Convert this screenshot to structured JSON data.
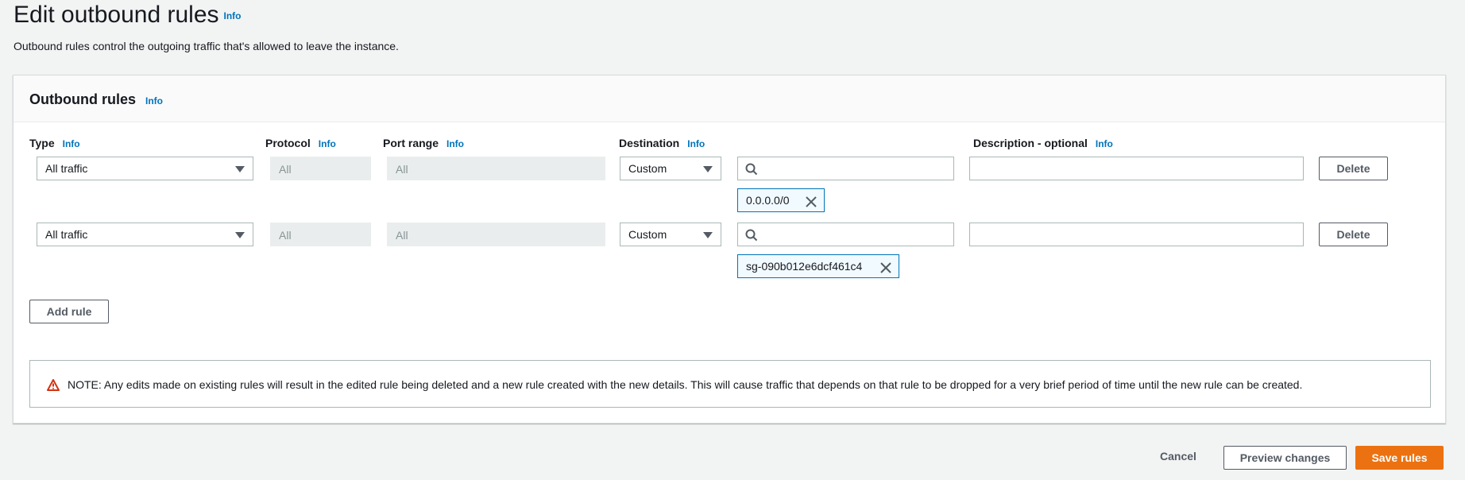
{
  "page": {
    "title": "Edit outbound rules",
    "title_info": "Info",
    "description": "Outbound rules control the outgoing traffic that's allowed to leave the instance."
  },
  "panel": {
    "title": "Outbound rules",
    "info": "Info"
  },
  "columns": {
    "type": "Type",
    "protocol": "Protocol",
    "port_range": "Port range",
    "destination": "Destination",
    "description": "Description - optional",
    "info": "Info"
  },
  "rules": [
    {
      "type": "All traffic",
      "protocol": "All",
      "port_range": "All",
      "destination_mode": "Custom",
      "destination_search": "",
      "destination_token": "0.0.0.0/0",
      "description": "",
      "delete_label": "Delete"
    },
    {
      "type": "All traffic",
      "protocol": "All",
      "port_range": "All",
      "destination_mode": "Custom",
      "destination_search": "",
      "destination_token": "sg-090b012e6dcf461c4",
      "description": "",
      "delete_label": "Delete"
    }
  ],
  "add_rule_label": "Add rule",
  "alert": {
    "text": "NOTE: Any edits made on existing rules will result in the edited rule being deleted and a new rule created with the new details. This will cause traffic that depends on that rule to be dropped for a very brief period of time until the new rule can be created."
  },
  "footer": {
    "cancel": "Cancel",
    "preview": "Preview changes",
    "save": "Save rules"
  },
  "colors": {
    "primary": "#ec7211",
    "link": "#0073bb",
    "warning": "#d13212"
  }
}
